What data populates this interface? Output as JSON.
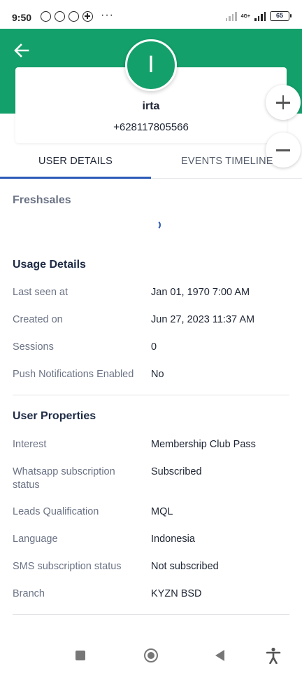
{
  "status_bar": {
    "time": "9:50",
    "icons": [
      "alarm-icon",
      "whatsapp-icon",
      "whatsapp-business-icon",
      "add-circle-icon",
      "more-dots-icon"
    ],
    "more": "···",
    "network_label": "4G+",
    "battery": "65"
  },
  "header": {
    "color": "#14a06b",
    "avatar_letter": "I",
    "name": "irta",
    "phone": "+628117805566"
  },
  "tabs": [
    {
      "label": "USER DETAILS",
      "active": true
    },
    {
      "label": "EVENTS TIMELINE",
      "active": false
    }
  ],
  "freshsales": {
    "title": "Freshsales"
  },
  "usage_details": {
    "title": "Usage Details",
    "rows": [
      {
        "label": "Last seen at",
        "value": "Jan 01, 1970 7:00 AM"
      },
      {
        "label": "Created on",
        "value": "Jun 27, 2023 11:37 AM"
      },
      {
        "label": "Sessions",
        "value": "0"
      },
      {
        "label": "Push Notifications Enabled",
        "value": "No"
      }
    ]
  },
  "user_properties": {
    "title": "User Properties",
    "rows": [
      {
        "label": "Interest",
        "value": "Membership Club Pass"
      },
      {
        "label": "Whatsapp subscription status",
        "value": "Subscribed"
      },
      {
        "label": "Leads Qualification",
        "value": "MQL"
      },
      {
        "label": "Language",
        "value": "Indonesia"
      },
      {
        "label": "SMS subscription status",
        "value": "Not subscribed"
      },
      {
        "label": "Branch",
        "value": "KYZN BSD"
      }
    ]
  },
  "colors": {
    "accent": "#14a06b",
    "tab_indicator": "#2d5bb8",
    "label": "#6b7385",
    "heading": "#1d2a44"
  }
}
